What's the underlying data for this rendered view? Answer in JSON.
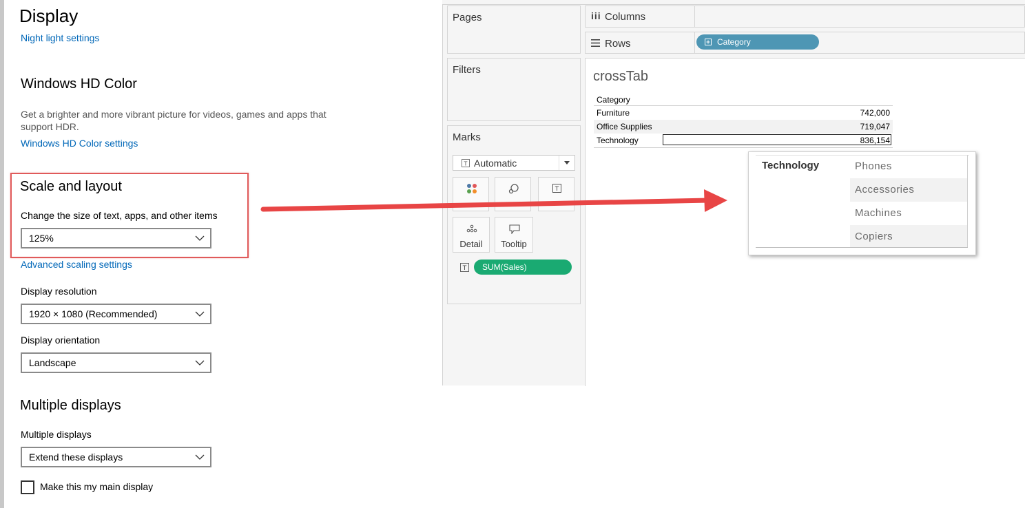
{
  "settings": {
    "title": "Display",
    "night_light_link": "Night light settings",
    "hd_color": {
      "heading": "Windows HD Color",
      "description_line1": "Get a brighter and more vibrant picture for videos, games and apps that",
      "description_line2": "support HDR.",
      "link": "Windows HD Color settings"
    },
    "scale": {
      "heading": "Scale and layout",
      "label": "Change the size of text, apps, and other items",
      "value": "125%",
      "advanced_link": "Advanced scaling settings"
    },
    "resolution": {
      "label": "Display resolution",
      "value": "1920 × 1080 (Recommended)"
    },
    "orientation": {
      "label": "Display orientation",
      "value": "Landscape"
    },
    "multiple": {
      "heading": "Multiple displays",
      "label": "Multiple displays",
      "value": "Extend these displays",
      "main_display_checkbox": "Make this my main display"
    }
  },
  "tableau": {
    "pages_title": "Pages",
    "filters_title": "Filters",
    "marks": {
      "title": "Marks",
      "type": "Automatic",
      "buttons": [
        "Color",
        "Size",
        "Text",
        "Detail",
        "Tooltip"
      ],
      "pill": "SUM(Sales)"
    },
    "columns_label": "Columns",
    "rows_label": "Rows",
    "rows_pill": "Category",
    "sheet_title": "crossTab",
    "crosstab": {
      "header": "Category",
      "rows": [
        {
          "category": "Furniture",
          "value": "742,000"
        },
        {
          "category": "Office Supplies",
          "value": "719,047"
        },
        {
          "category": "Technology",
          "value": "836,154"
        }
      ]
    },
    "colors": {
      "rows_pill": "#4e96b4",
      "sum_pill": "#1aaa72"
    }
  },
  "popup": {
    "category": "Technology",
    "subcategories": [
      "Phones",
      "Accessories",
      "Machines",
      "Copiers"
    ]
  },
  "annotation": {
    "arrow_color": "#e84545",
    "highlight_color": "#e05a5a"
  }
}
